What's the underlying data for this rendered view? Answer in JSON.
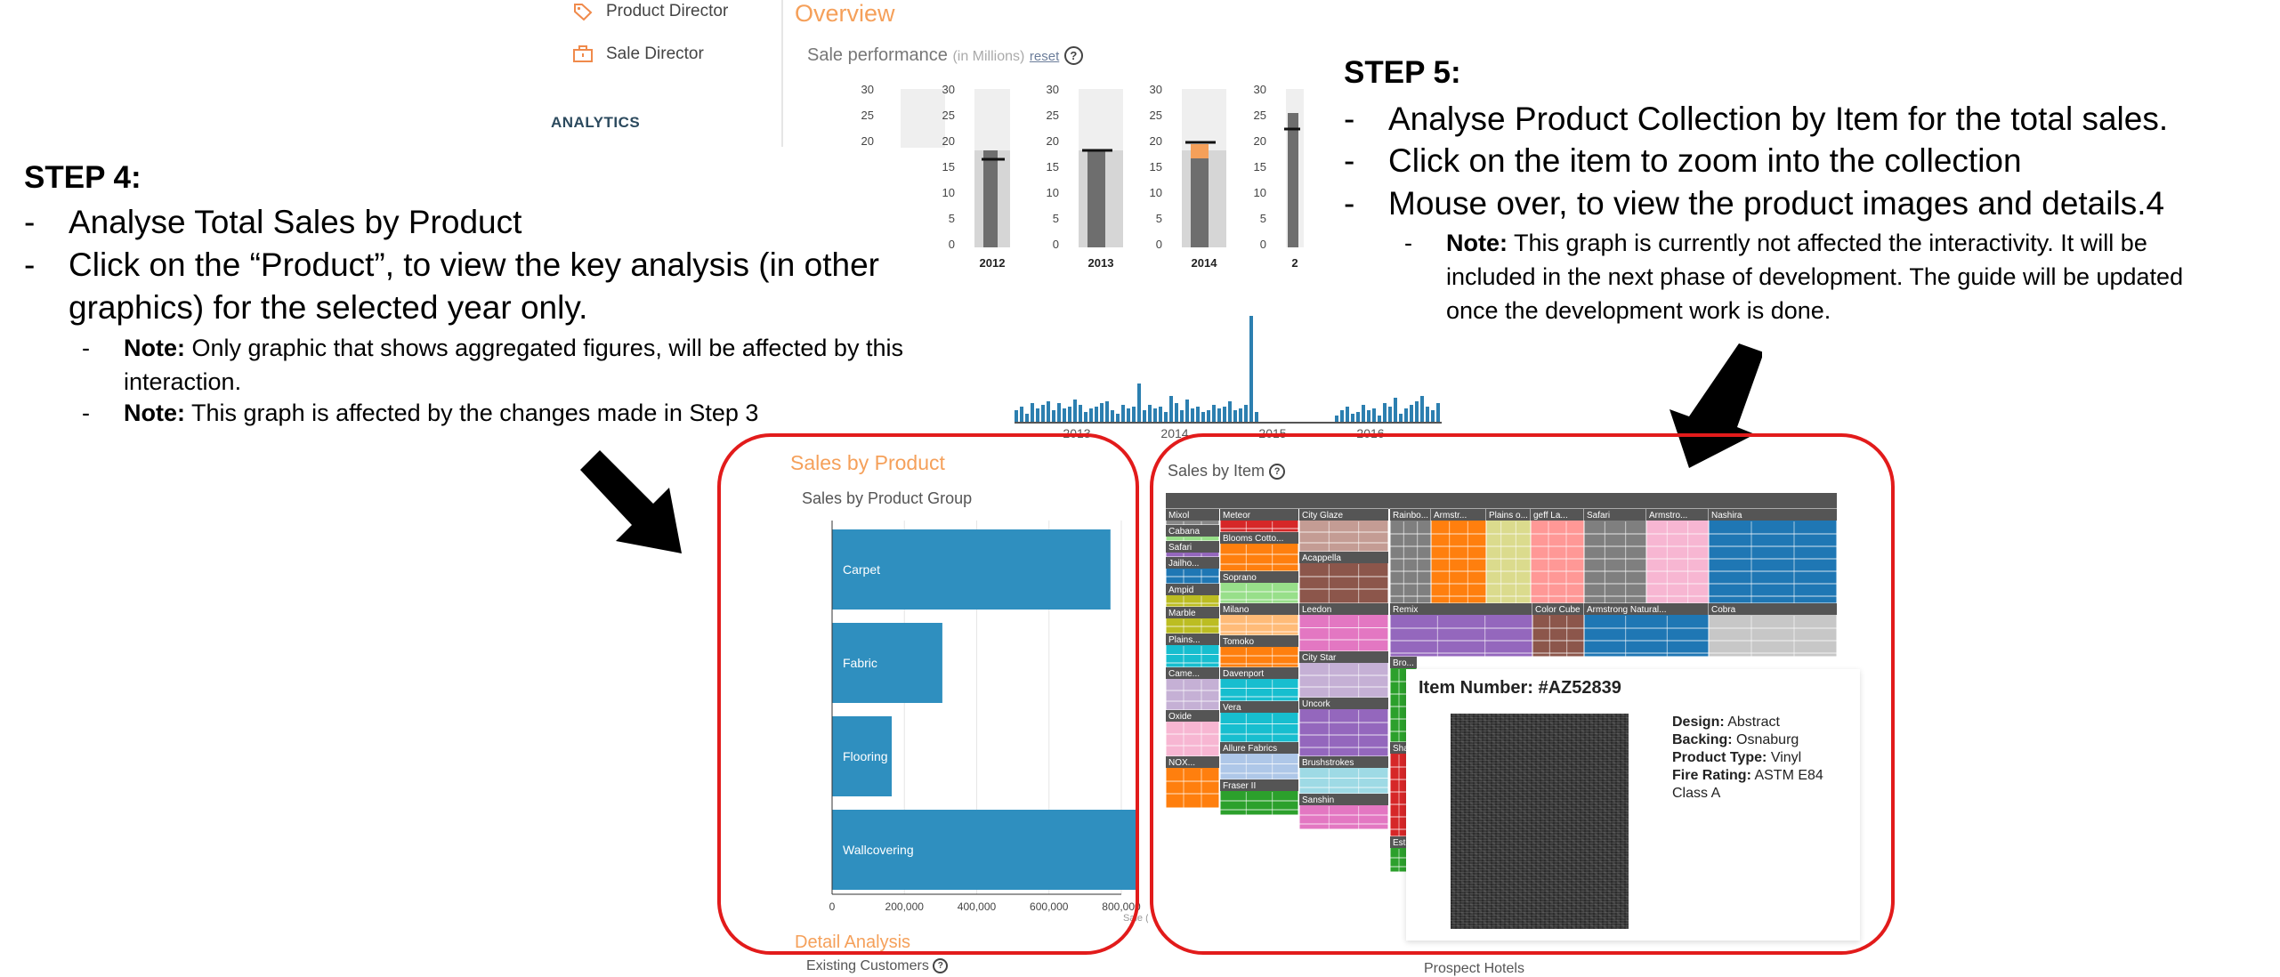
{
  "step4": {
    "title": "STEP 4:",
    "bullets": [
      "Analyse Total Sales by Product",
      "Click on the “Product”, to view the key analysis (in other",
      "graphics) for the selected year only."
    ],
    "notes": [
      {
        "label": "Note:",
        "text": "Only graphic that shows aggregated figures, will be affected by this",
        "cont": "interaction."
      },
      {
        "label": "Note:",
        "text": "This graph is affected by the changes made in Step 3"
      }
    ]
  },
  "step5": {
    "title": "STEP 5:",
    "bullets": [
      "Analyse Product Collection by Item for the total sales.",
      "Click on the item to zoom into the collection",
      "Mouse over, to view the product images and details.4"
    ],
    "note": {
      "label": "Note:",
      "lines": [
        "This graph is currently not affected the interactivity. It will be",
        "included in the next phase of development. The guide will be updated",
        "once the development work is done."
      ]
    }
  },
  "dashboard": {
    "sidebar": [
      {
        "label": "Product Director",
        "icon": "tag-icon"
      },
      {
        "label": "Sale Director",
        "icon": "briefcase-icon"
      }
    ],
    "analytics_label": "ANALYTICS",
    "overview_title": "Overview",
    "perf_label": "Sale performance",
    "perf_unit": "(in Millions)",
    "reset": "reset",
    "help": "?",
    "bullet_years": [
      "2012",
      "2013",
      "2014",
      "2"
    ],
    "bullet_ticks": [
      "30",
      "25",
      "20",
      "15",
      "10",
      "5",
      "0"
    ],
    "timeline_labels": [
      "2013",
      "2014",
      "2015",
      "2016"
    ]
  },
  "sales_by_product": {
    "title": "Sales by Product",
    "subtitle": "Sales by Product Group",
    "axis_label": "Sale ($)",
    "detail_title": "Detail Analysis",
    "existing_label": "Existing Customers"
  },
  "chart_data": {
    "type": "bar",
    "orientation": "horizontal",
    "title": "Sales by Product Group",
    "categories": [
      "Carpet",
      "Fabric",
      "Flooring",
      "Wallcovering"
    ],
    "values": [
      770000,
      305000,
      165000,
      840000
    ],
    "xlim": [
      0,
      800000
    ],
    "xticks": [
      "0",
      "200,000",
      "400,000",
      "600,000",
      "800,000"
    ],
    "xlabel": "Sale ($)",
    "grid": true,
    "bar_color": "#2f8fbf"
  },
  "sales_by_item": {
    "title": "Sales by Item",
    "prospect_label": "Prospect Hotels",
    "groups": [
      {
        "name": "Mixol",
        "color": "#888888"
      },
      {
        "name": "Meteor",
        "color": "#d62728"
      },
      {
        "name": "City Glaze",
        "color": "#c49c94"
      },
      {
        "name": "Rainbo...",
        "color": "#7f7f7f"
      },
      {
        "name": "Armstr...",
        "color": "#ff7f0e"
      },
      {
        "name": "Plains o...",
        "color": "#dbdb8d"
      },
      {
        "name": "geff La...",
        "color": "#ff9896"
      },
      {
        "name": "Safari",
        "color": "#7f7f7f"
      },
      {
        "name": "Armstro...",
        "color": "#f7b6d2"
      },
      {
        "name": "Nashira",
        "color": "#1f77b4"
      },
      {
        "name": "Cabana",
        "color": "#98df8a"
      },
      {
        "name": "Safari",
        "color": "#9467bd"
      },
      {
        "name": "Blooms Cotto...",
        "color": "#ff7f0e"
      },
      {
        "name": "Acappella",
        "color": "#8c564b"
      },
      {
        "name": "Jailho...",
        "color": "#1f77b4"
      },
      {
        "name": "Soprano",
        "color": "#98df8a"
      },
      {
        "name": "Ampid",
        "color": "#bcbd22"
      },
      {
        "name": "Milano",
        "color": "#ffbb78"
      },
      {
        "name": "Leedon",
        "color": "#e377c2"
      },
      {
        "name": "Remix",
        "color": "#9467bd"
      },
      {
        "name": "Color Cube",
        "color": "#8c564b"
      },
      {
        "name": "Armstrong Natural...",
        "color": "#1f77b4"
      },
      {
        "name": "Cobra",
        "color": "#c7c7c7"
      },
      {
        "name": "Marble",
        "color": "#bcbd22"
      },
      {
        "name": "Tomoko",
        "color": "#ff7f0e"
      },
      {
        "name": "City Star",
        "color": "#c5b0d5"
      },
      {
        "name": "Plains...",
        "color": "#17becf"
      },
      {
        "name": "Davenport",
        "color": "#17becf"
      },
      {
        "name": "Uncork",
        "color": "#9467bd"
      },
      {
        "name": "Came...",
        "color": "#c5b0d5"
      },
      {
        "name": "Vera",
        "color": "#17becf"
      },
      {
        "name": "Oxide",
        "color": "#f7b6d2"
      },
      {
        "name": "Allure Fabrics",
        "color": "#aec7e8"
      },
      {
        "name": "Brushstrokes",
        "color": "#9edae5"
      },
      {
        "name": "NOX...",
        "color": "#ff7f0e"
      },
      {
        "name": "Fraser II",
        "color": "#2ca02c"
      },
      {
        "name": "Sanshin",
        "color": "#e377c2"
      },
      {
        "name": "Bro...",
        "color": "#2ca02c"
      },
      {
        "name": "Sha...",
        "color": "#d62728"
      },
      {
        "name": "Esta...",
        "color": "#2ca02c"
      }
    ]
  },
  "tooltip": {
    "title": "Item Number: #AZ52839",
    "design_label": "Design:",
    "design": "Abstract",
    "backing_label": "Backing:",
    "backing": "Osnaburg",
    "type_label": "Product Type:",
    "type": "Vinyl",
    "fire_label": "Fire Rating:",
    "fire": "ASTM E84",
    "fire_class": "Class A"
  }
}
